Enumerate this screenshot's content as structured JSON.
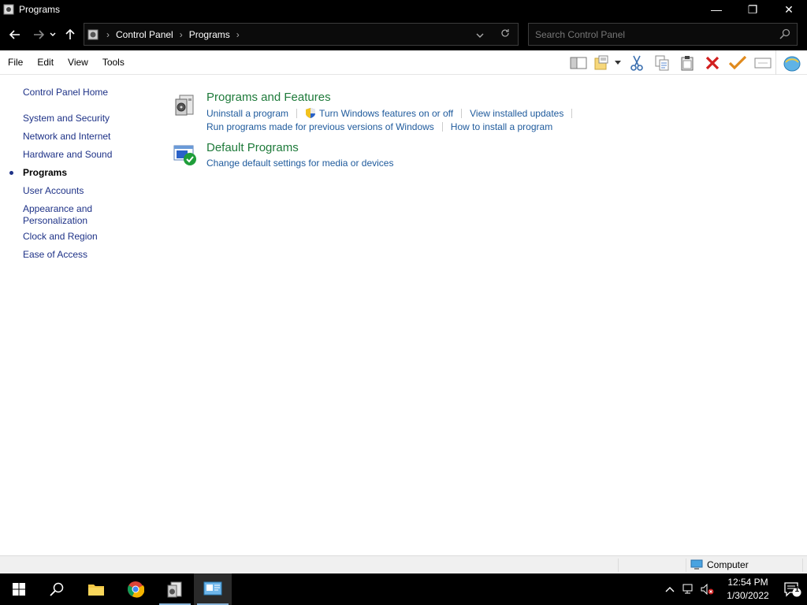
{
  "window": {
    "title": "Programs",
    "minimize_glyph": "—",
    "maximize_glyph": "❐",
    "close_glyph": "✕"
  },
  "address": {
    "crumbs": [
      "Control Panel",
      "Programs"
    ]
  },
  "search": {
    "placeholder": "Search Control Panel"
  },
  "menu": {
    "items": [
      "File",
      "Edit",
      "View",
      "Tools"
    ]
  },
  "sidebar": {
    "items": [
      "Control Panel Home",
      "System and Security",
      "Network and Internet",
      "Hardware and Sound",
      "Programs",
      "User Accounts",
      "Appearance and Personalization",
      "Clock and Region",
      "Ease of Access"
    ],
    "appearance_line1": "Appearance and",
    "appearance_line2": "Personalization",
    "active_item": "Programs"
  },
  "categories": [
    {
      "title": "Programs and Features",
      "links_row1": [
        "Uninstall a program",
        "Turn Windows features on or off",
        "View installed updates"
      ],
      "links_row2": [
        "Run programs made for previous versions of Windows",
        "How to install a program"
      ],
      "icon": "programs-features-icon"
    },
    {
      "title": "Default Programs",
      "links_row1": [
        "Change default settings for media or devices"
      ],
      "icon": "default-programs-icon"
    }
  ],
  "statusbar": {
    "location": "Computer"
  },
  "taskbar": {
    "time": "12:54 PM",
    "date": "1/30/2022",
    "notification_count": "1"
  },
  "colors": {
    "link": "#1e5a9c",
    "category_title": "#1e7a3a",
    "sidebar_link": "#1e3287"
  }
}
